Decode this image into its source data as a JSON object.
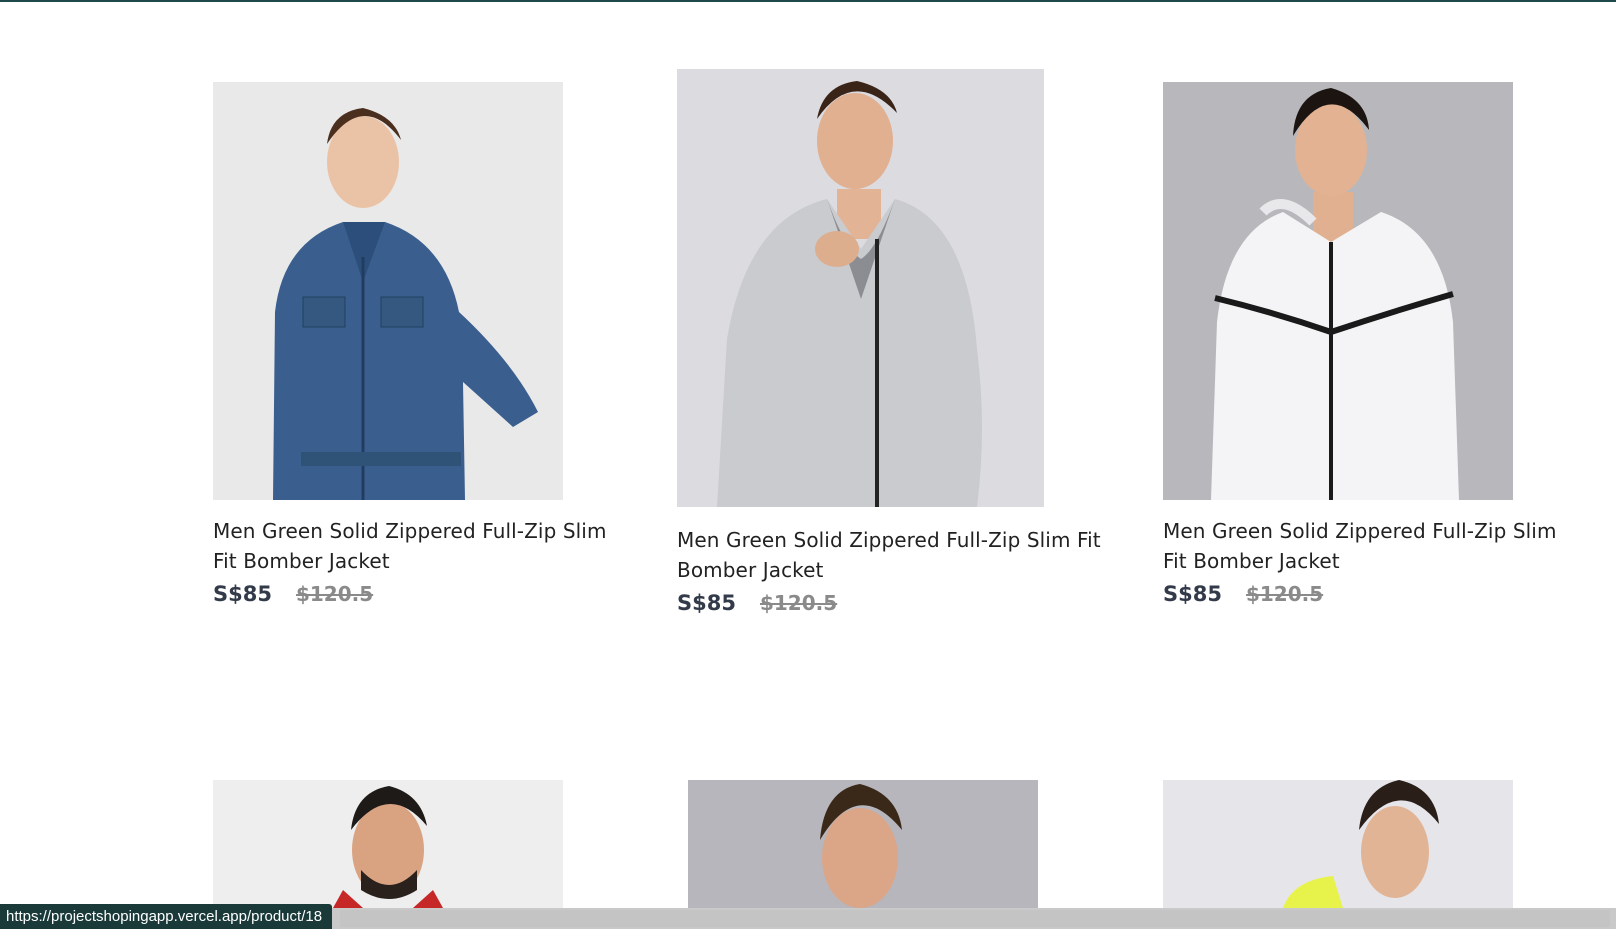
{
  "products": [
    {
      "title": "Men Green Solid Zippered Full-Zip Slim Fit Bomber Jacket",
      "price": "S$85",
      "old_price": "$120.5",
      "image": "denim-jacket"
    },
    {
      "title": "Men Green Solid Zippered Full-Zip Slim Fit Bomber Jacket",
      "price": "S$85",
      "old_price": "$120.5",
      "image": "grey-track-jacket"
    },
    {
      "title": "Men Green Solid Zippered Full-Zip Slim Fit Bomber Jacket",
      "price": "S$85",
      "old_price": "$120.5",
      "image": "white-windcheater"
    }
  ],
  "row2_images": [
    "red-hooded-jacket",
    "grey-jacket",
    "yellow-hoodie"
  ],
  "status_bar": {
    "url": "https://projectshopingapp.vercel.app/product/18"
  },
  "colors": {
    "accent": "#1f4a4a",
    "price": "#333b4a"
  }
}
